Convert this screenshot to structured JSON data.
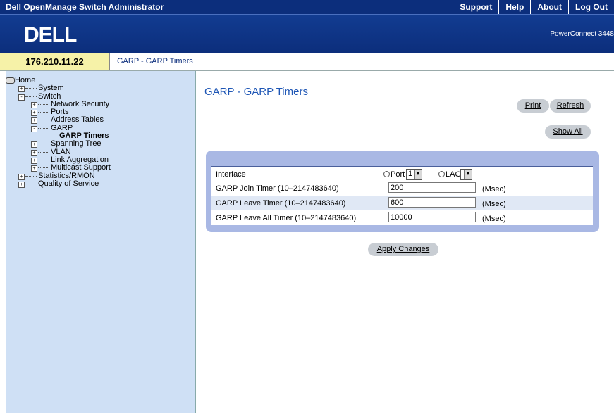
{
  "header": {
    "app_title": "Dell OpenManage Switch Administrator",
    "links": [
      "Support",
      "Help",
      "About",
      "Log Out"
    ],
    "logo_text": "DELL",
    "model": "PowerConnect 3448"
  },
  "address": {
    "ip": "176.210.11.22",
    "breadcrumb": "GARP - GARP Timers"
  },
  "tree": [
    {
      "label": "Home",
      "level": 0,
      "toggle": "",
      "icon": "home-icon"
    },
    {
      "label": "System",
      "level": 1,
      "toggle": "+"
    },
    {
      "label": "Switch",
      "level": 1,
      "toggle": "-"
    },
    {
      "label": "Network Security",
      "level": 2,
      "toggle": "+"
    },
    {
      "label": "Ports",
      "level": 2,
      "toggle": "+"
    },
    {
      "label": "Address Tables",
      "level": 2,
      "toggle": "+"
    },
    {
      "label": "GARP",
      "level": 2,
      "toggle": "-"
    },
    {
      "label": "GARP Timers",
      "level": 3,
      "toggle": "",
      "active": true
    },
    {
      "label": "Spanning Tree",
      "level": 2,
      "toggle": "+"
    },
    {
      "label": "VLAN",
      "level": 2,
      "toggle": "+"
    },
    {
      "label": "Link Aggregation",
      "level": 2,
      "toggle": "+"
    },
    {
      "label": "Multicast Support",
      "level": 2,
      "toggle": "+"
    },
    {
      "label": "Statistics/RMON",
      "level": 1,
      "toggle": "+"
    },
    {
      "label": "Quality of Service",
      "level": 1,
      "toggle": "+"
    }
  ],
  "page": {
    "title": "GARP - GARP Timers",
    "print_label": "Print",
    "refresh_label": "Refresh",
    "show_all_label": "Show All",
    "apply_label": "Apply Changes"
  },
  "form": {
    "interface_label": "Interface",
    "port_label": "Port",
    "port_value": "1",
    "lag_label": "LAG",
    "lag_value": "",
    "rows": [
      {
        "label": "GARP Join Timer (10–2147483640)",
        "value": "200",
        "unit": "(Msec)"
      },
      {
        "label": "GARP Leave Timer (10–2147483640)",
        "value": "600",
        "unit": "(Msec)"
      },
      {
        "label": "GARP Leave All Timer (10–2147483640)",
        "value": "10000",
        "unit": "(Msec)"
      }
    ]
  },
  "colors": {
    "header_bg": "#0c2e7c",
    "sidebar_bg": "#cfe0f5",
    "panel_bg": "#a9b8e4",
    "title_blue": "#1e56b5",
    "ip_bg": "#f6f2a8"
  }
}
